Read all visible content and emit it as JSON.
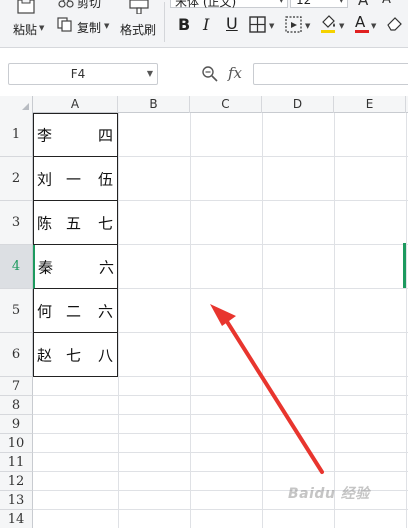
{
  "ribbon": {
    "paste_label": "粘贴",
    "cut_label": "剪切",
    "copy_label": "复制",
    "format_painter_label": "格式刷",
    "font_name": "宋体 (正文)",
    "font_size": "12",
    "bold": "B",
    "italic": "I",
    "underline": "U",
    "font_color_glyph": "A",
    "font_color": "#e02020",
    "fill_color": "#f5d200",
    "grow_font_glyph": "A"
  },
  "formula_bar": {
    "name_box": "F4",
    "fx_label": "fx",
    "formula_value": ""
  },
  "sheet": {
    "columns": [
      "A",
      "B",
      "C",
      "D",
      "E"
    ],
    "rows": [
      "1",
      "2",
      "3",
      "4",
      "5",
      "6",
      "7",
      "8",
      "9",
      "10",
      "11",
      "12",
      "13",
      "14"
    ],
    "active_row": "4",
    "column_a_cells": [
      [
        "李",
        "",
        "四"
      ],
      [
        "刘",
        "一",
        "伍"
      ],
      [
        "陈",
        "五",
        "七"
      ],
      [
        "秦",
        "",
        "六"
      ],
      [
        "何",
        "二",
        "六"
      ],
      [
        "赵",
        "七",
        "八"
      ]
    ]
  },
  "annotation": {
    "arrow_color": "#e8352e"
  },
  "watermark": {
    "text": "Baidu 经验"
  }
}
